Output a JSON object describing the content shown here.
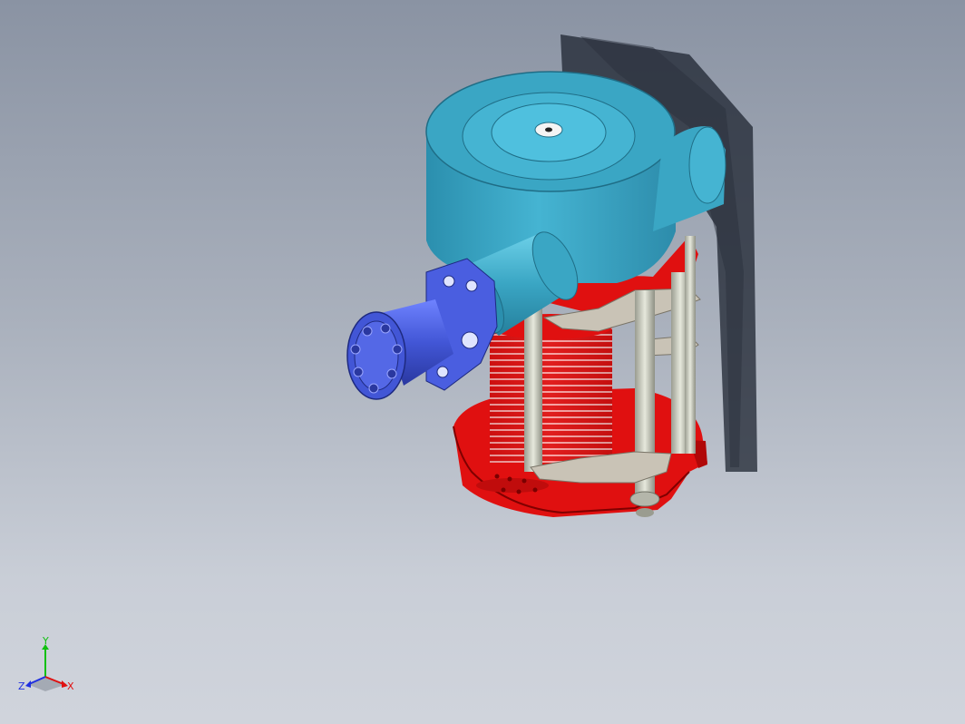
{
  "viewport": {
    "background_top": "#8a93a3",
    "background_bottom": "#d0d4dc"
  },
  "model": {
    "housing_color": "#3aa6c4",
    "motor_color": "#4256d6",
    "drum_color": "#e01010",
    "rod_color": "#c8cac0",
    "bracket_color": "#c9c3b6"
  },
  "triad": {
    "x_label": "X",
    "y_label": "Y",
    "z_label": "Z",
    "x_color": "#e01010",
    "y_color": "#10c010",
    "z_color": "#2030e0"
  }
}
